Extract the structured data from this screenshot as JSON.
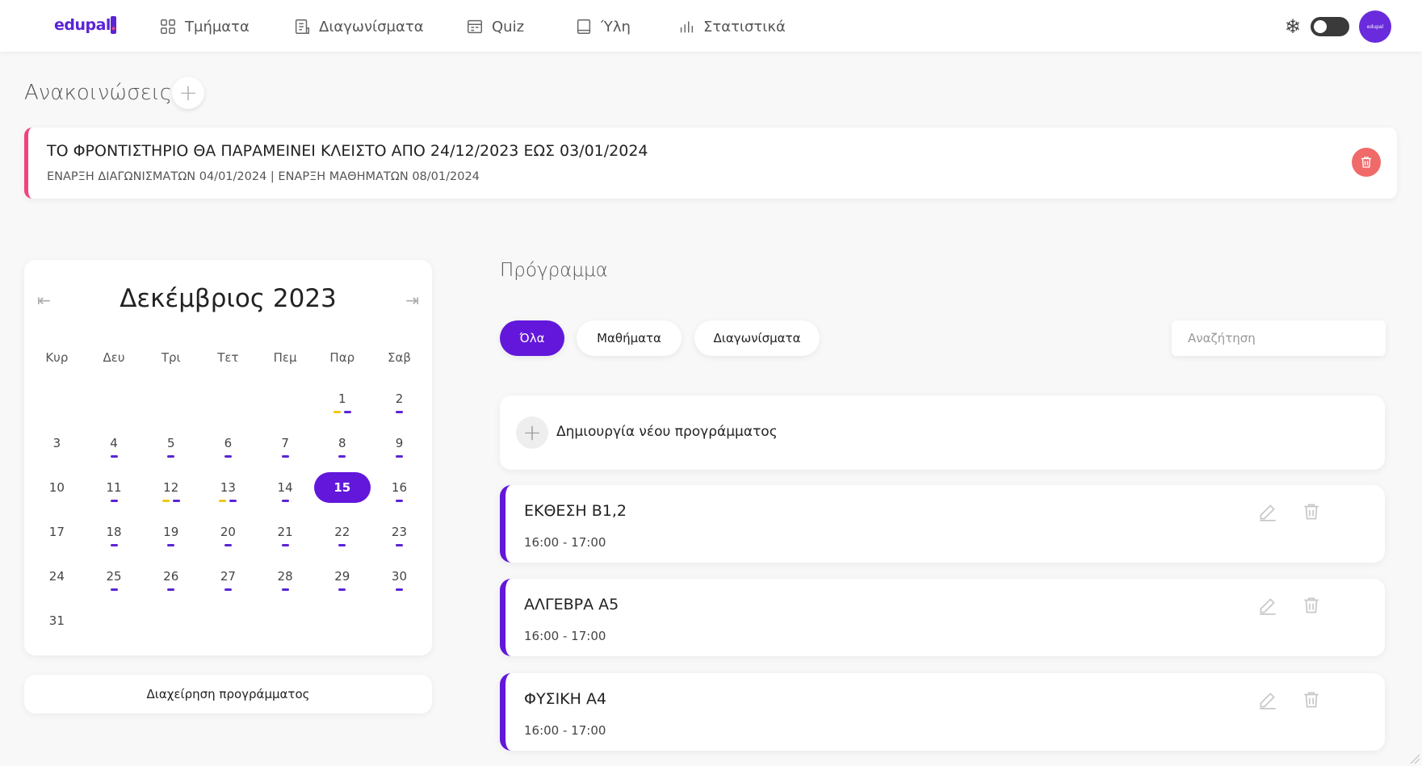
{
  "brand": {
    "logo_text": "edupal",
    "logo_dot": ".",
    "accent": "#6217db",
    "alert": "#f0437a"
  },
  "nav": {
    "items": [
      {
        "label": "Τμήματα",
        "icon": "grid-icon"
      },
      {
        "label": "Διαγωνίσματα",
        "icon": "document-icon"
      },
      {
        "label": "Quiz",
        "icon": "quiz-icon"
      },
      {
        "label": "Ύλη",
        "icon": "book-icon"
      },
      {
        "label": "Στατιστικά",
        "icon": "chart-icon"
      }
    ],
    "snow_icon": "❄",
    "avatar_text": "edupal"
  },
  "announcements": {
    "title": "Ανακοινώσεις",
    "items": [
      {
        "title": "ΤΟ ΦΡΟΝΤΙΣΤΗΡΙΟ ΘΑ ΠΑΡΑΜΕΙΝΕΙ ΚΛΕΙΣΤΟ ΑΠΟ 24/12/2023 ΕΩΣ 03/01/2024",
        "subtitle": "ΕΝΑΡΞΗ ΔΙΑΓΩΝΙΣΜΑΤΩΝ 04/01/2024 | ΕΝΑΡΞΗ ΜΑΘΗΜΑΤΩΝ 08/01/2024"
      }
    ]
  },
  "calendar": {
    "month_label": "Δεκέμβριος 2023",
    "prev": "⇤",
    "next": "⇥",
    "weekdays": [
      "Κυρ",
      "Δευ",
      "Τρι",
      "Τετ",
      "Πεμ",
      "Παρ",
      "Σαβ"
    ],
    "selected_day": 15,
    "weeks": [
      [
        null,
        null,
        null,
        null,
        null,
        {
          "d": 1,
          "dots": [
            "y",
            "p"
          ]
        },
        {
          "d": 2,
          "dots": [
            "p"
          ]
        }
      ],
      [
        {
          "d": 3,
          "dots": []
        },
        {
          "d": 4,
          "dots": [
            "p"
          ]
        },
        {
          "d": 5,
          "dots": [
            "p"
          ]
        },
        {
          "d": 6,
          "dots": [
            "p"
          ]
        },
        {
          "d": 7,
          "dots": [
            "p"
          ]
        },
        {
          "d": 8,
          "dots": [
            "p"
          ]
        },
        {
          "d": 9,
          "dots": [
            "p"
          ]
        }
      ],
      [
        {
          "d": 10,
          "dots": []
        },
        {
          "d": 11,
          "dots": [
            "p"
          ]
        },
        {
          "d": 12,
          "dots": [
            "y",
            "p"
          ]
        },
        {
          "d": 13,
          "dots": [
            "y",
            "p"
          ]
        },
        {
          "d": 14,
          "dots": [
            "p"
          ]
        },
        {
          "d": 15,
          "dots": []
        },
        {
          "d": 16,
          "dots": [
            "p"
          ]
        }
      ],
      [
        {
          "d": 17,
          "dots": []
        },
        {
          "d": 18,
          "dots": [
            "p"
          ]
        },
        {
          "d": 19,
          "dots": [
            "p"
          ]
        },
        {
          "d": 20,
          "dots": [
            "p"
          ]
        },
        {
          "d": 21,
          "dots": [
            "p"
          ]
        },
        {
          "d": 22,
          "dots": [
            "p"
          ]
        },
        {
          "d": 23,
          "dots": [
            "p"
          ]
        }
      ],
      [
        {
          "d": 24,
          "dots": []
        },
        {
          "d": 25,
          "dots": [
            "p"
          ]
        },
        {
          "d": 26,
          "dots": [
            "p"
          ]
        },
        {
          "d": 27,
          "dots": [
            "p"
          ]
        },
        {
          "d": 28,
          "dots": [
            "p"
          ]
        },
        {
          "d": 29,
          "dots": [
            "p"
          ]
        },
        {
          "d": 30,
          "dots": [
            "p"
          ]
        }
      ],
      [
        {
          "d": 31,
          "dots": []
        },
        null,
        null,
        null,
        null,
        null,
        null
      ]
    ],
    "manage_label": "Διαχείρηση προγράμματος"
  },
  "schedule": {
    "title": "Πρόγραμμα",
    "filters": [
      "Όλα",
      "Μαθήματα",
      "Διαγωνίσματα"
    ],
    "active_filter": 0,
    "search_placeholder": "Αναζήτηση",
    "create_label": "Δημιουργία νέου προγράμματος",
    "lessons": [
      {
        "name": "ΕΚΘΕΣΗ Β1,2",
        "time": "16:00 - 17:00"
      },
      {
        "name": "ΑΛΓΕΒΡΑ Α5",
        "time": "16:00 - 17:00"
      },
      {
        "name": "ΦΥΣΙΚΗ Α4",
        "time": "16:00 - 17:00"
      }
    ]
  }
}
